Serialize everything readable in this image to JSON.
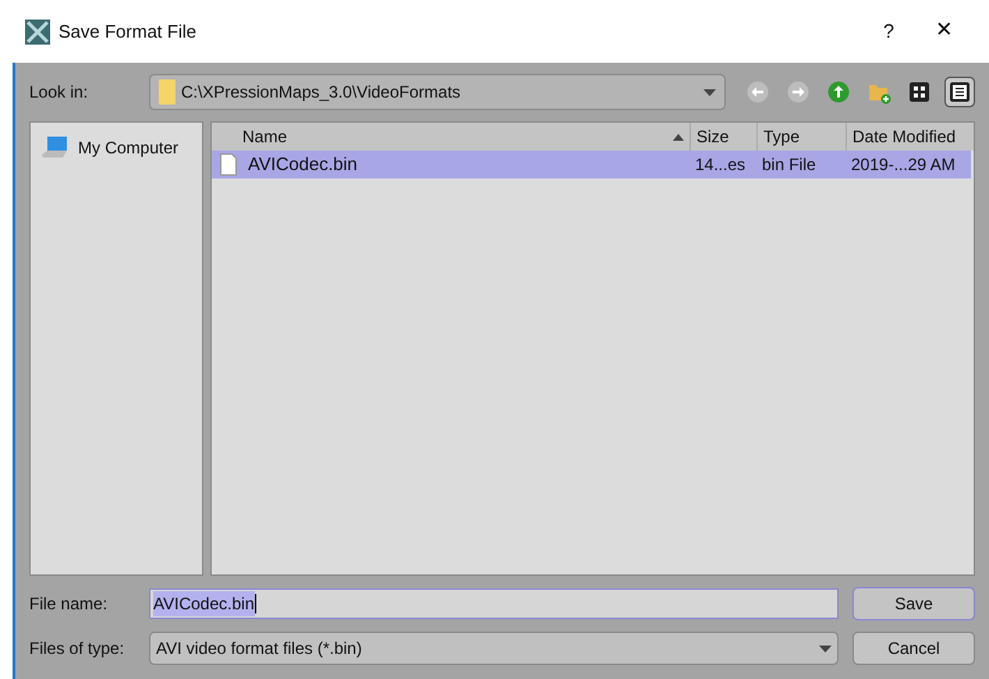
{
  "window": {
    "title": "Save Format File",
    "help": "?",
    "close": "✕"
  },
  "look_in": {
    "label": "Look in:",
    "path": "C:\\XPressionMaps_3.0\\VideoFormats"
  },
  "toolbar": [
    {
      "kind": "back",
      "disabled": true
    },
    {
      "kind": "forward",
      "disabled": true
    },
    {
      "kind": "up",
      "disabled": false
    },
    {
      "kind": "new-folder",
      "disabled": false
    },
    {
      "kind": "list-view",
      "selected": false
    },
    {
      "kind": "detail-view",
      "selected": true
    }
  ],
  "sidebar": {
    "items": [
      {
        "label": "My Computer"
      }
    ]
  },
  "table": {
    "columns": [
      {
        "label": "Name",
        "sorted": true
      },
      {
        "label": "Size",
        "sorted": false
      },
      {
        "label": "Type",
        "sorted": false
      },
      {
        "label": "Date Modified",
        "sorted": false
      }
    ],
    "rows": [
      {
        "selected": true,
        "cells": [
          "AVICodec.bin",
          "14...es",
          "bin File",
          "2019-...29 AM"
        ]
      }
    ]
  },
  "file_name": {
    "label": "File name:",
    "value": "AVICodec.bin"
  },
  "file_type": {
    "label": "Files of type:",
    "value": "AVI video format files (*.bin)"
  },
  "buttons": [
    "Save",
    "Cancel"
  ]
}
